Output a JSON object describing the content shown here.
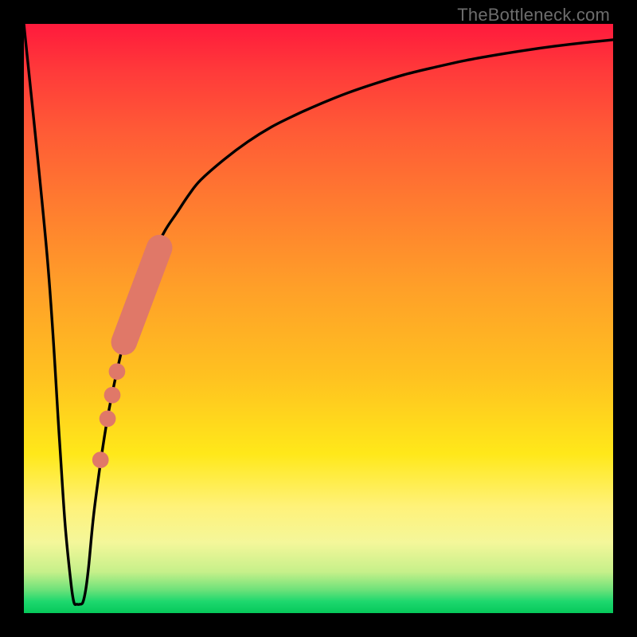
{
  "watermark": "TheBottleneck.com",
  "chart_data": {
    "type": "line",
    "title": "",
    "xlabel": "",
    "ylabel": "",
    "xlim": [
      0,
      100
    ],
    "ylim": [
      0,
      100
    ],
    "grid": false,
    "series": [
      {
        "name": "bottleneck-curve",
        "color": "#000000",
        "x": [
          0,
          4,
          6,
          7,
          8,
          8.5,
          9,
          9.5,
          10,
          10.5,
          11,
          12,
          14,
          16,
          18,
          20,
          22,
          24,
          26,
          28,
          30,
          34,
          38,
          42,
          46,
          50,
          55,
          60,
          65,
          70,
          75,
          80,
          85,
          90,
          95,
          100
        ],
        "y": [
          100,
          60,
          30,
          15,
          5,
          1.8,
          1.5,
          1.5,
          1.8,
          4,
          8,
          18,
          32,
          42,
          50,
          56,
          61,
          65,
          68,
          71,
          73.5,
          77,
          80,
          82.5,
          84.5,
          86.3,
          88.3,
          90,
          91.5,
          92.7,
          93.8,
          94.7,
          95.5,
          96.2,
          96.8,
          97.3
        ]
      }
    ],
    "highlight_segment": {
      "name": "your-range",
      "color": "#e07868",
      "thick_band": {
        "x": [
          17,
          23
        ],
        "y": [
          46,
          62
        ]
      },
      "dots": [
        {
          "x": 15.8,
          "y": 41
        },
        {
          "x": 15.0,
          "y": 37
        },
        {
          "x": 14.2,
          "y": 33
        },
        {
          "x": 13.0,
          "y": 26
        }
      ],
      "dot_radius": 1.4,
      "band_radius": 2.2
    }
  }
}
